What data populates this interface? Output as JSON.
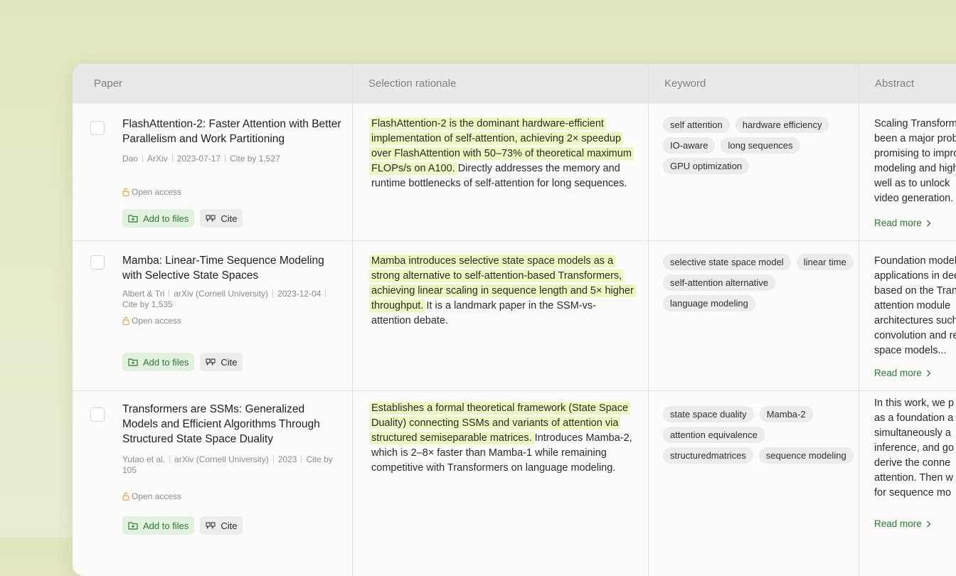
{
  "headers": {
    "paper": "Paper",
    "rationale": "Selection rationale",
    "keyword": "Keyword",
    "abstract": "Abstract"
  },
  "labels": {
    "open_access": "Open access",
    "add_to_files": "Add to files",
    "cite": "Cite",
    "read_more": "Read more"
  },
  "icons": {
    "lock": "open-lock-icon",
    "add": "folder-add-icon",
    "cite": "quote-icon",
    "chevron": "chevron-right-icon"
  },
  "colors": {
    "accent_green": "#2c7a32",
    "button_green_bg": "#e3f1df",
    "highlight": "#ecf8bf",
    "open_access_icon": "#e8a24a"
  },
  "papers": [
    {
      "title": "FlashAttention-2: Faster Attention with Better Parallelism and Work Partitioning",
      "authors": "Dao",
      "venue": "ArXiv",
      "date": "2023-07-17",
      "cites": "Cite by 1,527",
      "rationale_highlight": "FlashAttention-2 is the dominant hardware-efficient implementation of self-attention, achieving 2× speedup over FlashAttention with 50–73% of theoretical maximum FLOPs/s on A100.",
      "rationale_rest": " Directly addresses the memory and runtime bottlenecks of self-attention for long sequences.",
      "keywords": [
        "self attention",
        "hardware efficiency",
        "IO-aware",
        "long sequences",
        "GPU optimization"
      ],
      "abstract_lines": [
        "Scaling Transformers",
        "been a major problem",
        "promising to improve",
        "modeling and high",
        "well as to unlock",
        "video generation."
      ]
    },
    {
      "title": "Mamba: Linear-Time Sequence Modeling with Selective State Spaces",
      "authors": "Albert & Tri",
      "venue": "arXiv (Cornell University)",
      "date": "2023-12-04",
      "cites": "Cite by 1,535",
      "rationale_highlight": "Mamba introduces selective state space models as a strong alternative to self-attention-based Transformers, achieving linear scaling in sequence length and 5× higher throughput.",
      "rationale_rest": " It is a landmark paper in the SSM-vs-attention debate.",
      "keywords": [
        "selective state space model",
        "linear time",
        "self-attention alternative",
        "language modeling"
      ],
      "abstract_lines": [
        "Foundation models",
        "applications in deep",
        "based on the Trans",
        "attention module",
        "architectures such",
        "convolution and re",
        "space models..."
      ]
    },
    {
      "title": "Transformers are SSMs: Generalized Models and Efficient Algorithms Through Structured State Space Duality",
      "authors": "Yutao et al.",
      "venue": "arXiv (Cornell University)",
      "date": "2023",
      "cites": "Cite by 105",
      "rationale_highlight": "Establishes a formal theoretical framework (State Space Duality) connecting SSMs and variants of attention via structured semiseparable matrices.",
      "rationale_rest": " Introduces Mamba-2, which is 2–8× faster than Mamba-1 while remaining competitive with Transformers on language modeling.",
      "keywords": [
        "state space duality",
        "Mamba-2",
        "attention equivalence",
        "structuredmatrices",
        "sequence modeling"
      ],
      "abstract_lines": [
        "In this work, we p",
        "as a foundation a",
        "simultaneously a",
        "inference, and go",
        "derive the conne",
        "attention. Then w",
        "for sequence mo"
      ]
    }
  ]
}
